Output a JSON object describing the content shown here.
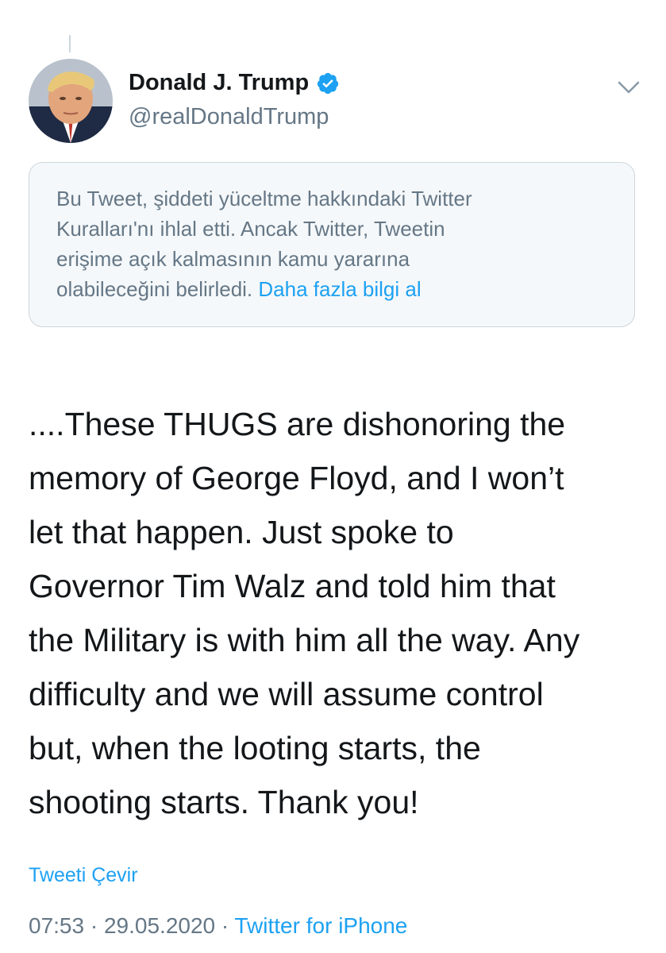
{
  "tweet": {
    "author": {
      "display_name": "Donald J. Trump",
      "handle": "@realDonaldTrump",
      "verified": true
    },
    "notice": {
      "text": "Bu Tweet, şiddeti yüceltme hakkındaki Twitter Kuralları'nı ihlal etti. Ancak Twitter, Tweetin erişime açık kalmasının kamu yararına olabileceğini belirledi.",
      "lines": [
        "Bu Tweet, şiddeti yüceltme hakkındaki Twitter",
        "Kuralları'nı ihlal etti. Ancak Twitter, Tweetin",
        "erişime açık kalmasının kamu yararına",
        "olabileceğini belirledi."
      ],
      "link_label": "Daha fazla bilgi al"
    },
    "body_lines": [
      "....These THUGS are dishonoring the",
      "memory of George Floyd, and I won’t",
      "let that happen. Just spoke to",
      "Governor Tim Walz and told him that",
      "the Military is with him all the way. Any",
      "difficulty and we will assume control",
      "but, when the looting starts, the",
      "shooting starts. Thank you!"
    ],
    "translate_label": "Tweeti Çevir",
    "time": "07:53",
    "date": "29.05.2020",
    "separator": "·",
    "source": "Twitter for iPhone"
  },
  "icons": {
    "verified": "verified-badge-icon",
    "menu": "chevron-down-icon"
  },
  "colors": {
    "primary_text": "#14171a",
    "secondary_text": "#657786",
    "accent": "#1da1f2",
    "notice_bg": "#f5f8fa",
    "border": "#ccd6dd"
  }
}
